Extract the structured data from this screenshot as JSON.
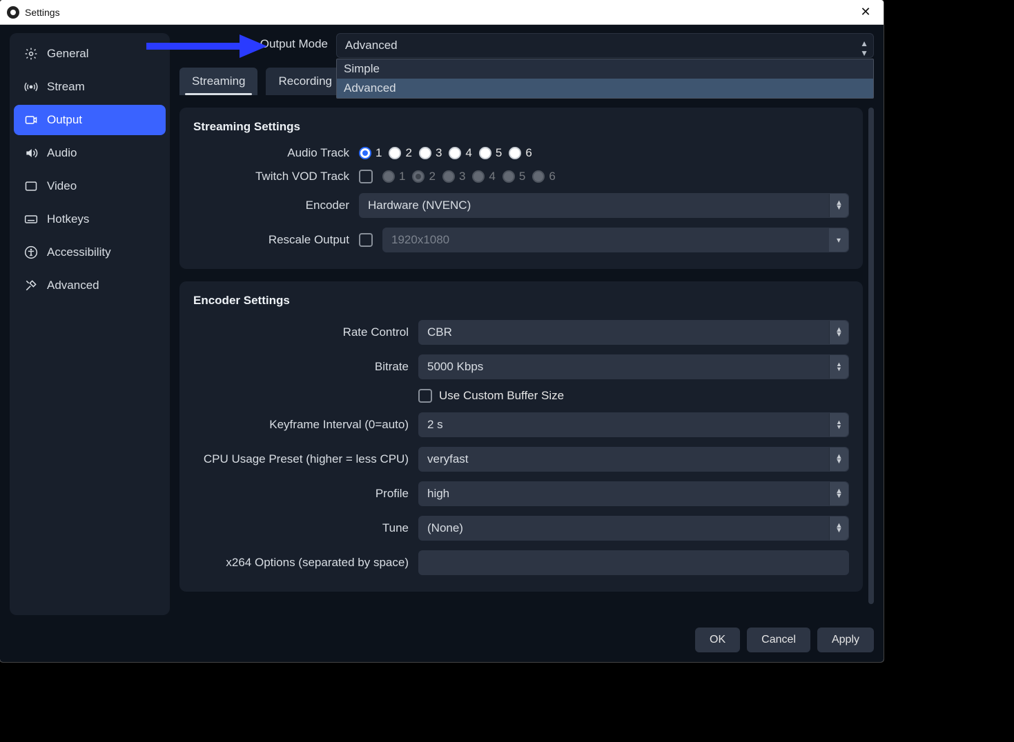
{
  "window": {
    "title": "Settings"
  },
  "sidebar": {
    "items": [
      {
        "label": "General"
      },
      {
        "label": "Stream"
      },
      {
        "label": "Output"
      },
      {
        "label": "Audio"
      },
      {
        "label": "Video"
      },
      {
        "label": "Hotkeys"
      },
      {
        "label": "Accessibility"
      },
      {
        "label": "Advanced"
      }
    ],
    "active_index": 2
  },
  "output_mode": {
    "label": "Output Mode",
    "value": "Advanced",
    "options": [
      "Simple",
      "Advanced"
    ],
    "highlighted_option_index": 1
  },
  "tabs": {
    "items": [
      "Streaming",
      "Recording"
    ],
    "active_index": 0
  },
  "streaming_settings": {
    "heading": "Streaming Settings",
    "audio_track": {
      "label": "Audio Track",
      "options": [
        "1",
        "2",
        "3",
        "4",
        "5",
        "6"
      ],
      "selected_index": 0
    },
    "twitch_vod_track": {
      "label": "Twitch VOD Track",
      "enabled": false,
      "options": [
        "1",
        "2",
        "3",
        "4",
        "5",
        "6"
      ],
      "selected_index": 1
    },
    "encoder": {
      "label": "Encoder",
      "value": "Hardware (NVENC)"
    },
    "rescale_output": {
      "label": "Rescale Output",
      "enabled": false,
      "value": "1920x1080"
    }
  },
  "encoder_settings": {
    "heading": "Encoder Settings",
    "rate_control": {
      "label": "Rate Control",
      "value": "CBR"
    },
    "bitrate": {
      "label": "Bitrate",
      "value": "5000 Kbps"
    },
    "use_custom_buffer": {
      "label": "Use Custom Buffer Size",
      "checked": false
    },
    "keyframe_interval": {
      "label": "Keyframe Interval (0=auto)",
      "value": "2 s"
    },
    "cpu_preset": {
      "label": "CPU Usage Preset (higher = less CPU)",
      "value": "veryfast"
    },
    "profile": {
      "label": "Profile",
      "value": "high"
    },
    "tune": {
      "label": "Tune",
      "value": "(None)"
    },
    "x264_options": {
      "label": "x264 Options (separated by space)",
      "value": ""
    }
  },
  "footer": {
    "ok": "OK",
    "cancel": "Cancel",
    "apply": "Apply"
  }
}
